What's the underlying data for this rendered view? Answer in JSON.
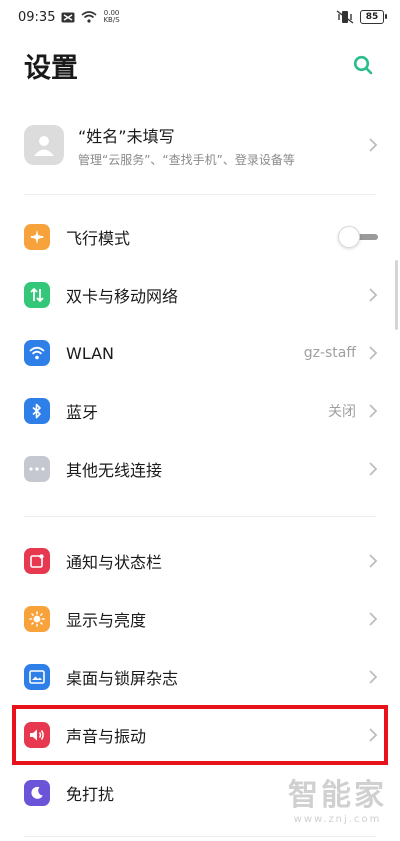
{
  "status_bar": {
    "time": "09:35",
    "net_speed_value": "0.00",
    "net_speed_unit": "KB/S",
    "battery": "85"
  },
  "header": {
    "title": "设置"
  },
  "profile": {
    "name": "“姓名”未填写",
    "subtitle": "管理“云服务”、“查找手机”、登录设备等"
  },
  "groups": [
    {
      "items": [
        {
          "label": "飞行模式",
          "icon": "airplane-icon",
          "color": "#f7a23b",
          "control": "toggle",
          "toggle_on": false
        },
        {
          "label": "双卡与移动网络",
          "icon": "sim-arrows-icon",
          "color": "#35c779",
          "control": "chevron"
        },
        {
          "label": "WLAN",
          "icon": "wifi-icon",
          "color": "#2f7fe8",
          "value": "gz-staff",
          "control": "chevron"
        },
        {
          "label": "蓝牙",
          "icon": "bluetooth-icon",
          "color": "#2f7fe8",
          "value": "关闭",
          "control": "chevron"
        },
        {
          "label": "其他无线连接",
          "icon": "more-dots-icon",
          "color": "#c5c8d0",
          "control": "chevron"
        }
      ]
    },
    {
      "items": [
        {
          "label": "通知与状态栏",
          "icon": "notification-icon",
          "color": "#e8384f",
          "control": "chevron"
        },
        {
          "label": "显示与亮度",
          "icon": "sun-icon",
          "color": "#f7a23b",
          "control": "chevron"
        },
        {
          "label": "桌面与锁屏杂志",
          "icon": "wallpaper-icon",
          "color": "#2f7fe8",
          "control": "chevron"
        },
        {
          "label": "声音与振动",
          "icon": "speaker-icon",
          "color": "#e8384f",
          "control": "chevron",
          "highlighted": true
        },
        {
          "label": "免打扰",
          "icon": "moon-icon",
          "color": "#6b54d8",
          "control": "none"
        }
      ]
    }
  ],
  "watermark": {
    "main": "智能家",
    "sub": "www.znj.com"
  },
  "colors": {
    "accent": "#2bbd8c",
    "highlight": "#e8121b"
  }
}
